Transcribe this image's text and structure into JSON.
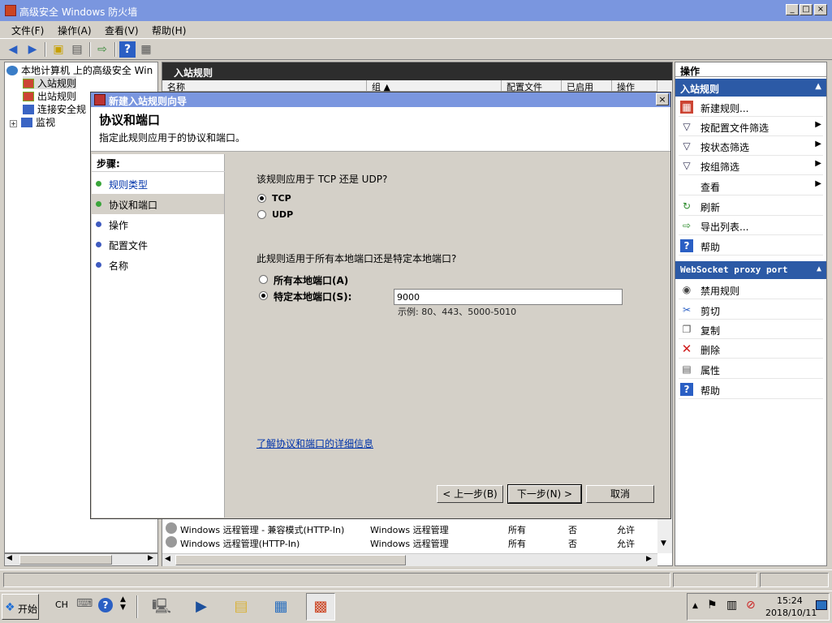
{
  "window": {
    "title": "高级安全 Windows 防火墙",
    "min_glyph": "_",
    "max_glyph": "□",
    "close_glyph": "×"
  },
  "menu": [
    "文件(F)",
    "操作(A)",
    "查看(V)",
    "帮助(H)"
  ],
  "tree": {
    "root": "本地计算机 上的高级安全 Win",
    "items": [
      "入站规则",
      "出站规则",
      "连接安全规",
      "监视"
    ],
    "expand_glyph": "+"
  },
  "center": {
    "header": "入站规则",
    "columns": [
      "名称",
      "组 ▲",
      "配置文件",
      "已启用",
      "操作"
    ],
    "rows": [
      {
        "name": "Windows 远程管理 - 兼容模式(HTTP-In)",
        "group": "Windows 远程管理",
        "profile": "所有",
        "enabled": "否",
        "action": "允许"
      },
      {
        "name": "Windows 远程管理(HTTP-In)",
        "group": "Windows 远程管理",
        "profile": "所有",
        "enabled": "否",
        "action": "允许"
      }
    ]
  },
  "actions": {
    "header": "操作",
    "section1": "入站规则",
    "section1_items": [
      {
        "label": "新建规则...",
        "icon": "new-rule-icon",
        "sub": false
      },
      {
        "label": "按配置文件筛选",
        "icon": "filter-icon",
        "sub": true
      },
      {
        "label": "按状态筛选",
        "icon": "filter-icon",
        "sub": true
      },
      {
        "label": "按组筛选",
        "icon": "filter-icon",
        "sub": true
      },
      {
        "label": "查看",
        "icon": "",
        "sub": true
      },
      {
        "label": "刷新",
        "icon": "refresh-icon",
        "sub": false
      },
      {
        "label": "导出列表...",
        "icon": "export-icon",
        "sub": false
      },
      {
        "label": "帮助",
        "icon": "help-icon",
        "sub": false
      }
    ],
    "section2": "WebSocket proxy port",
    "section2_items": [
      {
        "label": "禁用规则",
        "icon": "disable-icon"
      },
      {
        "label": "剪切",
        "icon": "cut-icon"
      },
      {
        "label": "复制",
        "icon": "copy-icon"
      },
      {
        "label": "删除",
        "icon": "delete-icon"
      },
      {
        "label": "属性",
        "icon": "properties-icon"
      },
      {
        "label": "帮助",
        "icon": "help-icon"
      }
    ]
  },
  "dialog": {
    "title": "新建入站规则向导",
    "heading": "协议和端口",
    "subheading": "指定此规则应用于的协议和端口。",
    "steps_title": "步骤:",
    "steps": [
      "规则类型",
      "协议和端口",
      "操作",
      "配置文件",
      "名称"
    ],
    "q1": "该规则应用于 TCP 还是 UDP?",
    "opt_tcp": "TCP",
    "opt_udp": "UDP",
    "q2": "此规则适用于所有本地端口还是特定本地端口?",
    "opt_all": "所有本地端口(A)",
    "opt_specific": "特定本地端口(S):",
    "port_value": "9000",
    "example": "示例: 80、443、5000-5010",
    "link": "了解协议和端口的详细信息",
    "btn_back": "< 上一步(B)",
    "btn_next": "下一步(N) >",
    "btn_cancel": "取消",
    "close_glyph": "×"
  },
  "taskbar": {
    "start": "开始",
    "lang": "CH",
    "time": "15:24",
    "date": "2018/10/11"
  },
  "colors": {
    "title_bar": "#7a96df",
    "section_header": "#2c5aa6",
    "center_header": "#2d2d2d",
    "green_dot": "#3aa53a",
    "blue_dot": "#3f5bbf"
  }
}
